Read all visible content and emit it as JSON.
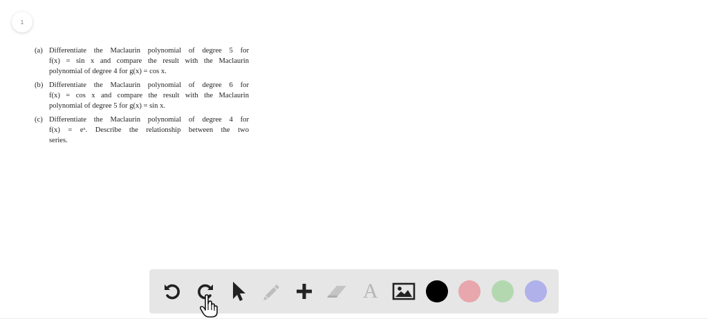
{
  "page_badge": "1",
  "problem": {
    "parts": [
      {
        "label": "(a)",
        "lines": [
          "Differentiate the Maclaurin polynomial of degree 5 for",
          "f(x) = sin x and compare the result with the Maclaurin",
          "polynomial of degree 4 for g(x) = cos x."
        ]
      },
      {
        "label": "(b)",
        "lines": [
          "Differentiate the Maclaurin polynomial of degree 6 for",
          "f(x) = cos x and compare the result with the Maclaurin",
          "polynomial of degree 5 for g(x) = sin x."
        ]
      },
      {
        "label": "(c)",
        "lines": [
          "Differentiate the Maclaurin polynomial of degree 4 for",
          "f(x) = eˣ. Describe the relationship between the two",
          "series."
        ]
      }
    ]
  },
  "toolbar": {
    "tools": [
      {
        "icon": "undo-icon"
      },
      {
        "icon": "redo-icon"
      },
      {
        "icon": "pointer-arrow-icon"
      },
      {
        "icon": "pencil-icon"
      },
      {
        "icon": "plus-icon"
      },
      {
        "icon": "eraser-icon"
      },
      {
        "icon": "text-icon"
      },
      {
        "icon": "image-icon"
      }
    ],
    "text_tool_glyph": "A",
    "colors": [
      {
        "name": "black",
        "hex": "#000000"
      },
      {
        "name": "pink",
        "hex": "#e8a6ad"
      },
      {
        "name": "green",
        "hex": "#b3d8b0"
      },
      {
        "name": "lavender",
        "hex": "#b0b0ea"
      }
    ]
  }
}
